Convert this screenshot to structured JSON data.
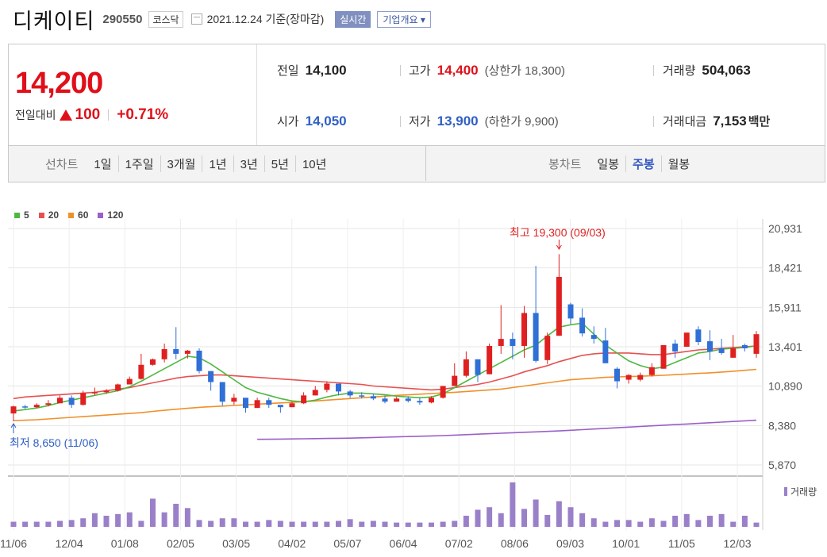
{
  "header": {
    "name": "디케이티",
    "code": "290550",
    "market": "코스닥",
    "date": "2021.12.24 기준(장마감)",
    "realtime": "실시간",
    "company_info": "기업개요"
  },
  "quote": {
    "price": "14,200",
    "change_label": "전일대비",
    "change": "100",
    "change_pct": "+0.71%",
    "prev_label": "전일",
    "prev": "14,100",
    "open_label": "시가",
    "open": "14,050",
    "high_label": "고가",
    "high": "14,400",
    "upper_limit": "(상한가 18,300)",
    "low_label": "저가",
    "low": "13,900",
    "lower_limit": "(하한가 9,900)",
    "volume_label": "거래량",
    "volume": "504,063",
    "amount_label": "거래대금",
    "amount": "7,153",
    "amount_unit": "백만"
  },
  "tabs": {
    "line_label": "선차트",
    "line_periods": [
      "1일",
      "1주일",
      "3개월",
      "1년",
      "3년",
      "5년",
      "10년"
    ],
    "candle_label": "봉차트",
    "candle_periods": [
      "일봉",
      "주봉",
      "월봉"
    ],
    "candle_active": "주봉"
  },
  "colors": {
    "up": "#e02020",
    "down": "#2f6fd6",
    "ma5": "#50b840",
    "ma20": "#e85050",
    "ma60": "#f0902a",
    "ma120": "#9a60c8",
    "volume": "#9a80c8"
  },
  "chart_data": {
    "type": "candlestick",
    "legend": [
      "5",
      "20",
      "60",
      "120"
    ],
    "y_ticks": [
      "20,931",
      "18,421",
      "15,911",
      "13,401",
      "10,890",
      "8,380",
      "5,870"
    ],
    "ylim": [
      5870,
      20931
    ],
    "x_ticks": [
      "11/06",
      "12/04",
      "01/08",
      "02/05",
      "03/05",
      "04/02",
      "05/07",
      "06/04",
      "07/02",
      "08/06",
      "09/03",
      "10/01",
      "11/05",
      "12/03"
    ],
    "high_annotation": "최고 19,300 (09/03)",
    "low_annotation": "최저 8,650 (11/06)",
    "volume_label": "거래량",
    "candles": [
      [
        9150,
        9600,
        8650,
        9650
      ],
      [
        9600,
        9550,
        9450,
        9700
      ],
      [
        9550,
        9700,
        9500,
        9800
      ],
      [
        9700,
        9800,
        9600,
        10000
      ],
      [
        9800,
        10150,
        9850,
        10300
      ],
      [
        10150,
        9700,
        9500,
        10300
      ],
      [
        9700,
        10450,
        9650,
        10600
      ],
      [
        10450,
        10500,
        10300,
        10800
      ],
      [
        10500,
        10600,
        10400,
        10700
      ],
      [
        10600,
        11000,
        10550,
        11050
      ],
      [
        11000,
        11350,
        11000,
        11500
      ],
      [
        11350,
        12250,
        11300,
        12950
      ],
      [
        12250,
        12600,
        12200,
        12650
      ],
      [
        12600,
        13250,
        12400,
        13600
      ],
      [
        13250,
        12950,
        12600,
        14650
      ],
      [
        12950,
        13150,
        12650,
        13200
      ],
      [
        13150,
        11850,
        11700,
        13300
      ],
      [
        11850,
        11150,
        10600,
        11850
      ],
      [
        11150,
        9900,
        9650,
        11150
      ],
      [
        9900,
        10150,
        9700,
        10400
      ],
      [
        10150,
        9500,
        9200,
        10150
      ],
      [
        9500,
        10000,
        9600,
        10150
      ],
      [
        10000,
        9700,
        9500,
        10150
      ],
      [
        9700,
        9550,
        9200,
        9650
      ],
      [
        9550,
        9800,
        9550,
        9900
      ],
      [
        9800,
        10300,
        9750,
        10500
      ],
      [
        10300,
        10650,
        10300,
        10900
      ],
      [
        10650,
        11050,
        10500,
        11200
      ],
      [
        11050,
        10550,
        10300,
        11050
      ],
      [
        10550,
        10300,
        10150,
        10650
      ],
      [
        10300,
        10250,
        10100,
        10500
      ],
      [
        10250,
        10100,
        10000,
        10400
      ],
      [
        10100,
        9900,
        9800,
        10300
      ],
      [
        9900,
        10100,
        9900,
        10200
      ],
      [
        10100,
        9950,
        9850,
        10250
      ],
      [
        9950,
        9850,
        9700,
        10150
      ],
      [
        9850,
        10150,
        9800,
        10250
      ],
      [
        10150,
        10900,
        10100,
        10900
      ],
      [
        10900,
        11550,
        10900,
        12350
      ],
      [
        11550,
        12600,
        11450,
        13100
      ],
      [
        12600,
        11600,
        11150,
        12600
      ],
      [
        11650,
        13450,
        11650,
        13600
      ],
      [
        13450,
        13900,
        12950,
        16050
      ],
      [
        13900,
        13450,
        12600,
        14300
      ],
      [
        13450,
        15550,
        12700,
        16000
      ],
      [
        15550,
        12500,
        12400,
        18550
      ],
      [
        12550,
        14100,
        12300,
        14300
      ],
      [
        14100,
        17850,
        14100,
        19300
      ],
      [
        16100,
        15200,
        14850,
        16200
      ],
      [
        15250,
        14250,
        14050,
        15850
      ],
      [
        14150,
        13900,
        13600,
        14700
      ],
      [
        13800,
        12350,
        12350,
        14600
      ],
      [
        12000,
        11200,
        10750,
        12100
      ],
      [
        11300,
        11600,
        11050,
        11650
      ],
      [
        11300,
        11600,
        11200,
        11750
      ],
      [
        11600,
        12100,
        11500,
        12350
      ],
      [
        12000,
        13500,
        12000,
        13500
      ],
      [
        13600,
        13100,
        12700,
        13850
      ],
      [
        13400,
        14300,
        13400,
        14300
      ],
      [
        14500,
        13700,
        13500,
        14700
      ],
      [
        13750,
        13100,
        12550,
        14450
      ],
      [
        13300,
        13000,
        12900,
        13900
      ],
      [
        12700,
        13300,
        12900,
        14150
      ],
      [
        13500,
        13300,
        13100,
        13600
      ],
      [
        12950,
        14200,
        12700,
        14400
      ]
    ],
    "ma5": [
      9300,
      9400,
      9500,
      9650,
      9850,
      10000,
      10150,
      10300,
      10450,
      10600,
      10850,
      11200,
      11600,
      12000,
      12400,
      12800,
      12700,
      12300,
      11800,
      11300,
      10800,
      10500,
      10300,
      10100,
      9950,
      9900,
      10000,
      10200,
      10350,
      10450,
      10450,
      10400,
      10350,
      10250,
      10200,
      10150,
      10200,
      10400,
      10800,
      11200,
      11600,
      12000,
      12400,
      12800,
      13200,
      13500,
      14100,
      14650,
      14800,
      14900,
      14200,
      13500,
      13000,
      12500,
      12200,
      12000,
      12100,
      12400,
      12700,
      13000,
      13100,
      13250,
      13300,
      13350,
      13450
    ],
    "ma20": [
      10100,
      10200,
      10250,
      10300,
      10350,
      10400,
      10450,
      10500,
      10600,
      10700,
      10800,
      10950,
      11100,
      11250,
      11400,
      11500,
      11550,
      11600,
      11600,
      11550,
      11500,
      11450,
      11400,
      11350,
      11300,
      11250,
      11200,
      11150,
      11100,
      11050,
      11000,
      10900,
      10850,
      10800,
      10750,
      10700,
      10650,
      10700,
      10800,
      10900,
      11000,
      11150,
      11350,
      11550,
      11800,
      12000,
      12200,
      12450,
      12650,
      12850,
      12950,
      13000,
      13000,
      13000,
      12950,
      12900,
      12900,
      13000,
      13100,
      13200,
      13250,
      13300,
      13350,
      13400,
      13450
    ],
    "ma60_start": 0,
    "ma60": [
      8700,
      8720,
      8750,
      8800,
      8850,
      8900,
      8950,
      9000,
      9050,
      9100,
      9150,
      9200,
      9280,
      9350,
      9420,
      9480,
      9540,
      9580,
      9620,
      9660,
      9700,
      9740,
      9780,
      9820,
      9860,
      9900,
      9950,
      10000,
      10050,
      10100,
      10150,
      10200,
      10250,
      10300,
      10340,
      10380,
      10420,
      10460,
      10500,
      10550,
      10600,
      10650,
      10700,
      10800,
      10900,
      11000,
      11100,
      11200,
      11300,
      11350,
      11400,
      11450,
      11480,
      11500,
      11520,
      11550,
      11580,
      11620,
      11660,
      11700,
      11740,
      11790,
      11840,
      11900,
      11960
    ],
    "ma120_start": 21,
    "ma120": [
      7500,
      7510,
      7520,
      7530,
      7540,
      7550,
      7560,
      7570,
      7580,
      7600,
      7620,
      7640,
      7660,
      7680,
      7700,
      7720,
      7740,
      7770,
      7800,
      7830,
      7860,
      7890,
      7920,
      7950,
      7980,
      8010,
      8040,
      8080,
      8120,
      8160,
      8200,
      8240,
      8280,
      8320,
      8360,
      8400,
      8440,
      8480,
      8520,
      8560,
      8600,
      8640,
      8680,
      8720
    ],
    "volume": [
      6,
      6,
      6,
      6,
      7,
      8,
      10,
      16,
      13,
      15,
      17,
      7,
      33,
      17,
      27,
      22,
      8,
      7,
      10,
      10,
      6,
      6,
      8,
      7,
      6,
      6,
      6,
      6,
      7,
      9,
      6,
      7,
      6,
      5,
      5,
      5,
      5,
      6,
      7,
      13,
      20,
      23,
      16,
      52,
      21,
      32,
      14,
      30,
      23,
      16,
      10,
      6,
      8,
      8,
      6,
      10,
      7,
      13,
      15,
      8,
      13,
      15,
      6,
      13,
      5,
      8,
      14
    ]
  }
}
